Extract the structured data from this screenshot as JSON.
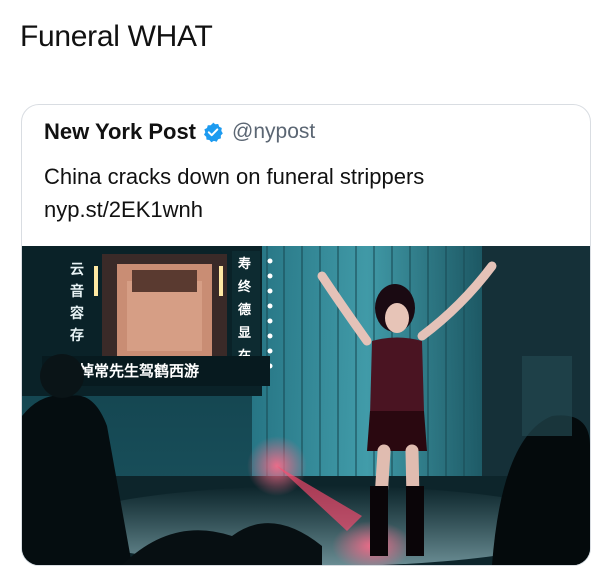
{
  "post": {
    "caption": "Funeral WHAT"
  },
  "tweet": {
    "author_name": "New York Post",
    "verified_icon": "verified-badge-icon",
    "handle": "@nypost",
    "text_line_1": "China cracks down on funeral strippers",
    "text_line_2": "nyp.st/2EK1wnh"
  },
  "photo": {
    "sign_text": "哀悼常先生驾鹤西游"
  },
  "colors": {
    "handle_gray": "#5b6673",
    "verified_blue": "#1d9bf0",
    "border": "#d9dde2"
  }
}
